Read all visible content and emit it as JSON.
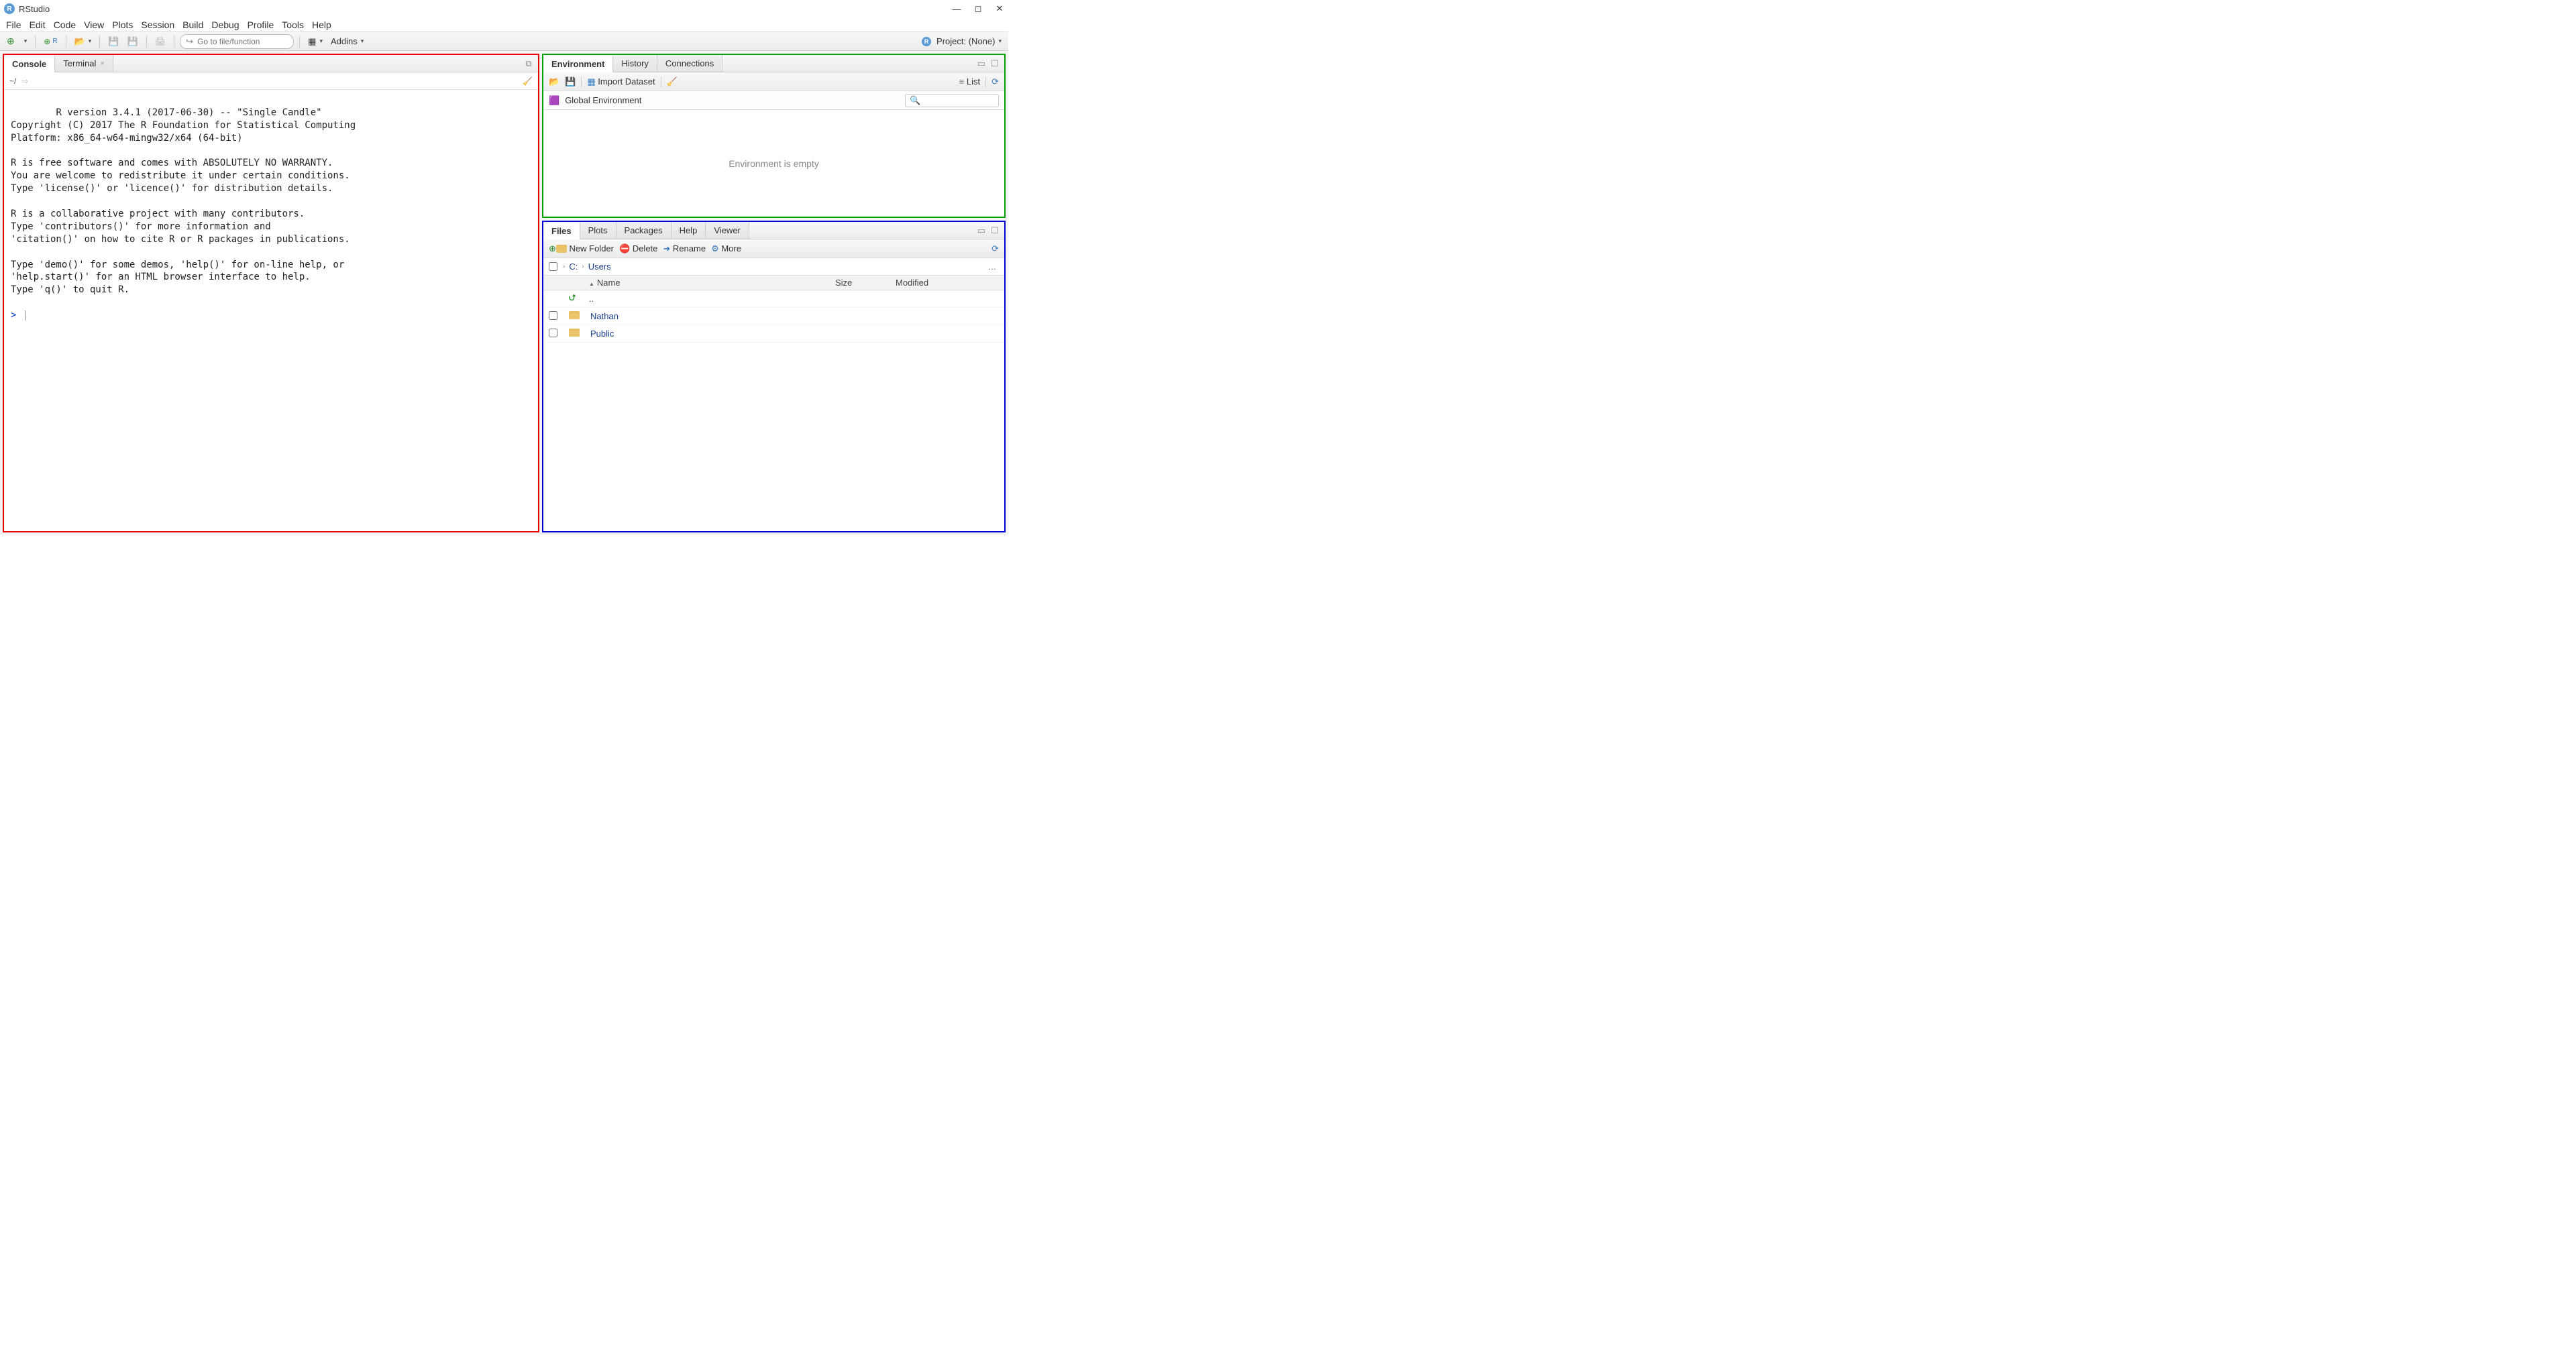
{
  "window": {
    "title": "RStudio"
  },
  "menus": [
    "File",
    "Edit",
    "Code",
    "View",
    "Plots",
    "Session",
    "Build",
    "Debug",
    "Profile",
    "Tools",
    "Help"
  ],
  "toolbar": {
    "goto_placeholder": "Go to file/function",
    "addins": "Addins",
    "project_label": "Project: (None)"
  },
  "console_pane": {
    "tabs": {
      "console": "Console",
      "terminal": "Terminal"
    },
    "path": "~/",
    "body": "R version 3.4.1 (2017-06-30) -- \"Single Candle\"\nCopyright (C) 2017 The R Foundation for Statistical Computing\nPlatform: x86_64-w64-mingw32/x64 (64-bit)\n\nR is free software and comes with ABSOLUTELY NO WARRANTY.\nYou are welcome to redistribute it under certain conditions.\nType 'license()' or 'licence()' for distribution details.\n\nR is a collaborative project with many contributors.\nType 'contributors()' for more information and\n'citation()' on how to cite R or R packages in publications.\n\nType 'demo()' for some demos, 'help()' for on-line help, or\n'help.start()' for an HTML browser interface to help.\nType 'q()' to quit R.\n",
    "prompt": ">"
  },
  "env_pane": {
    "tabs": {
      "environment": "Environment",
      "history": "History",
      "connections": "Connections"
    },
    "import_label": "Import Dataset",
    "scope_label": "Global Environment",
    "view_label": "List",
    "empty_text": "Environment is empty"
  },
  "files_pane": {
    "tabs": {
      "files": "Files",
      "plots": "Plots",
      "packages": "Packages",
      "help": "Help",
      "viewer": "Viewer"
    },
    "buttons": {
      "new_folder": "New Folder",
      "delete": "Delete",
      "rename": "Rename",
      "more": "More"
    },
    "breadcrumb": [
      "C:",
      "Users"
    ],
    "columns": {
      "name": "Name",
      "size": "Size",
      "modified": "Modified"
    },
    "up_label": "..",
    "rows": [
      {
        "name": "Nathan"
      },
      {
        "name": "Public"
      }
    ]
  }
}
